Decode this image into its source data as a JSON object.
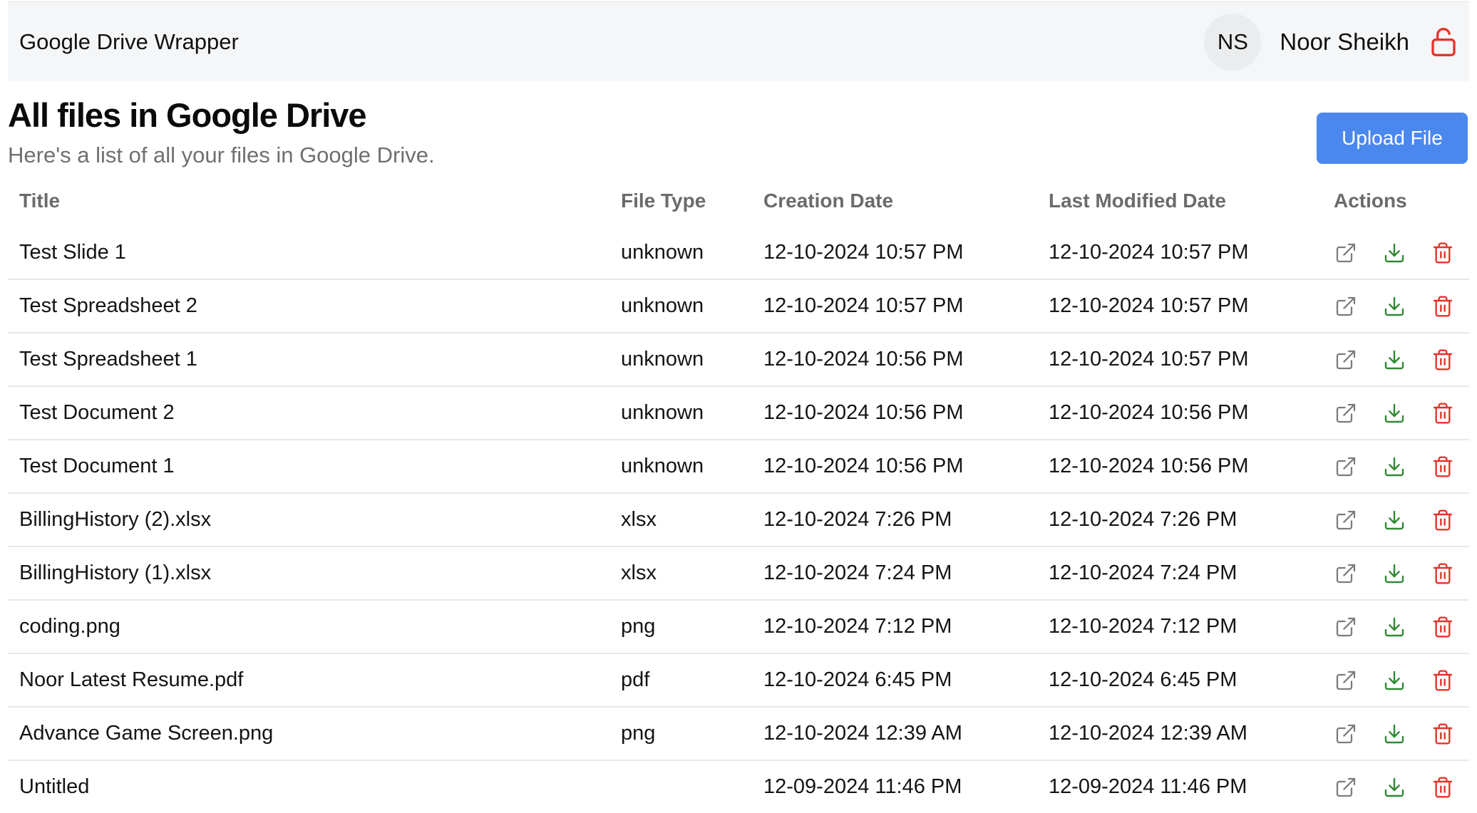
{
  "header": {
    "app_title": "Google Drive Wrapper",
    "avatar_initials": "NS",
    "user_name": "Noor Sheikh",
    "logout_icon": "unlock-icon"
  },
  "page": {
    "title": "All files in Google Drive",
    "subtitle": "Here's a list of all your files in Google Drive.",
    "upload_button_label": "Upload File"
  },
  "table": {
    "columns": [
      "Title",
      "File Type",
      "Creation Date",
      "Last Modified Date",
      "Actions"
    ],
    "rows": [
      {
        "title": "Test Slide 1",
        "type": "unknown",
        "created": "12-10-2024 10:57 PM",
        "modified": "12-10-2024 10:57 PM"
      },
      {
        "title": "Test Spreadsheet 2",
        "type": "unknown",
        "created": "12-10-2024 10:57 PM",
        "modified": "12-10-2024 10:57 PM"
      },
      {
        "title": "Test Spreadsheet 1",
        "type": "unknown",
        "created": "12-10-2024 10:56 PM",
        "modified": "12-10-2024 10:57 PM"
      },
      {
        "title": "Test Document 2",
        "type": "unknown",
        "created": "12-10-2024 10:56 PM",
        "modified": "12-10-2024 10:56 PM"
      },
      {
        "title": "Test Document 1",
        "type": "unknown",
        "created": "12-10-2024 10:56 PM",
        "modified": "12-10-2024 10:56 PM"
      },
      {
        "title": "BillingHistory (2).xlsx",
        "type": "xlsx",
        "created": "12-10-2024 7:26 PM",
        "modified": "12-10-2024 7:26 PM"
      },
      {
        "title": "BillingHistory (1).xlsx",
        "type": "xlsx",
        "created": "12-10-2024 7:24 PM",
        "modified": "12-10-2024 7:24 PM"
      },
      {
        "title": "coding.png",
        "type": "png",
        "created": "12-10-2024 7:12 PM",
        "modified": "12-10-2024 7:12 PM"
      },
      {
        "title": "Noor Latest Resume.pdf",
        "type": "pdf",
        "created": "12-10-2024 6:45 PM",
        "modified": "12-10-2024 6:45 PM"
      },
      {
        "title": "Advance Game Screen.png",
        "type": "png",
        "created": "12-10-2024 12:39 AM",
        "modified": "12-10-2024 12:39 AM"
      },
      {
        "title": "Untitled",
        "type": "",
        "created": "12-09-2024 11:46 PM",
        "modified": "12-09-2024 11:46 PM"
      }
    ],
    "row_actions": [
      "external-link-icon",
      "download-icon",
      "trash-icon"
    ]
  },
  "colors": {
    "accent": "#4a88ee",
    "header_bg": "#f5f6f8",
    "danger": "#e5342b",
    "success": "#2f8a32",
    "muted": "#6f6f6f"
  }
}
